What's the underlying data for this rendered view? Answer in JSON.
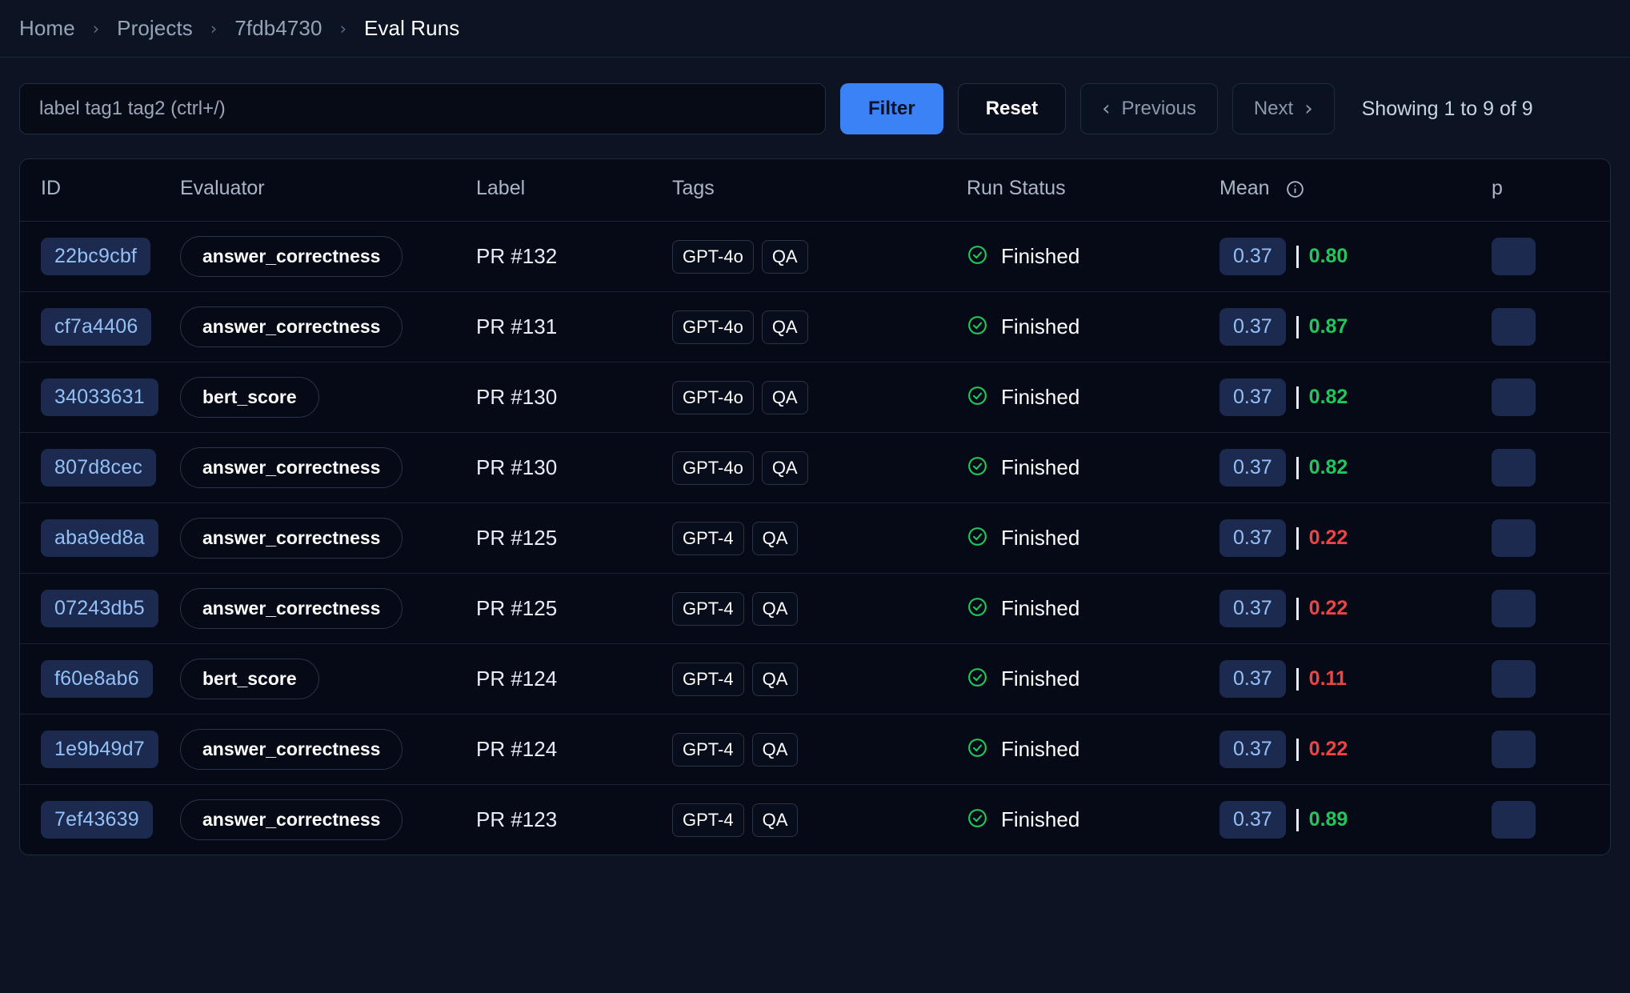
{
  "breadcrumb": {
    "items": [
      {
        "label": "Home",
        "current": false
      },
      {
        "label": "Projects",
        "current": false
      },
      {
        "label": "7fdb4730",
        "current": false
      },
      {
        "label": "Eval Runs",
        "current": true
      }
    ],
    "separator": "›"
  },
  "toolbar": {
    "search_placeholder": "label tag1 tag2 (ctrl+/)",
    "search_value": "",
    "filter_label": "Filter",
    "reset_label": "Reset",
    "previous_label": "Previous",
    "next_label": "Next",
    "prev_chevron": "‹",
    "next_chevron": "›",
    "showing_text": "Showing 1 to 9 of 9"
  },
  "table": {
    "headers": {
      "id": "ID",
      "evaluator": "Evaluator",
      "label": "Label",
      "tags": "Tags",
      "run_status": "Run Status",
      "mean": "Mean",
      "mean_info_icon": "info-icon",
      "p_partial": "p"
    },
    "rows": [
      {
        "id": "22bc9cbf",
        "evaluator": "answer_correctness",
        "label": "PR #132",
        "tags": [
          "GPT-4o",
          "QA"
        ],
        "status": "Finished",
        "mean_badge": "0.37",
        "score": "0.80",
        "score_state": "good"
      },
      {
        "id": "cf7a4406",
        "evaluator": "answer_correctness",
        "label": "PR #131",
        "tags": [
          "GPT-4o",
          "QA"
        ],
        "status": "Finished",
        "mean_badge": "0.37",
        "score": "0.87",
        "score_state": "good"
      },
      {
        "id": "34033631",
        "evaluator": "bert_score",
        "label": "PR #130",
        "tags": [
          "GPT-4o",
          "QA"
        ],
        "status": "Finished",
        "mean_badge": "0.37",
        "score": "0.82",
        "score_state": "good"
      },
      {
        "id": "807d8cec",
        "evaluator": "answer_correctness",
        "label": "PR #130",
        "tags": [
          "GPT-4o",
          "QA"
        ],
        "status": "Finished",
        "mean_badge": "0.37",
        "score": "0.82",
        "score_state": "good"
      },
      {
        "id": "aba9ed8a",
        "evaluator": "answer_correctness",
        "label": "PR #125",
        "tags": [
          "GPT-4",
          "QA"
        ],
        "status": "Finished",
        "mean_badge": "0.37",
        "score": "0.22",
        "score_state": "bad"
      },
      {
        "id": "07243db5",
        "evaluator": "answer_correctness",
        "label": "PR #125",
        "tags": [
          "GPT-4",
          "QA"
        ],
        "status": "Finished",
        "mean_badge": "0.37",
        "score": "0.22",
        "score_state": "bad"
      },
      {
        "id": "f60e8ab6",
        "evaluator": "bert_score",
        "label": "PR #124",
        "tags": [
          "GPT-4",
          "QA"
        ],
        "status": "Finished",
        "mean_badge": "0.37",
        "score": "0.11",
        "score_state": "bad"
      },
      {
        "id": "1e9b49d7",
        "evaluator": "answer_correctness",
        "label": "PR #124",
        "tags": [
          "GPT-4",
          "QA"
        ],
        "status": "Finished",
        "mean_badge": "0.37",
        "score": "0.22",
        "score_state": "bad"
      },
      {
        "id": "7ef43639",
        "evaluator": "answer_correctness",
        "label": "PR #123",
        "tags": [
          "GPT-4",
          "QA"
        ],
        "status": "Finished",
        "mean_badge": "0.37",
        "score": "0.89",
        "score_state": "good"
      }
    ]
  },
  "colors": {
    "accent": "#3b82f6",
    "badge_bg": "#1d2a50",
    "badge_text": "#93c0f5",
    "success": "#22c55e",
    "danger": "#ef4444",
    "page_bg": "#0c1322",
    "table_bg": "#050a16"
  },
  "icons": {
    "status_finished": "check-circle-icon"
  }
}
